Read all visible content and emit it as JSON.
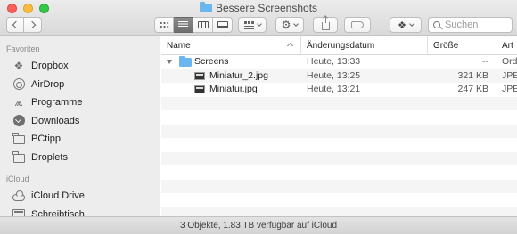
{
  "window": {
    "title": "Bessere Screenshots"
  },
  "toolbar": {
    "search_placeholder": "Suchen"
  },
  "sidebar": {
    "sections": [
      {
        "heading": "Favoriten"
      },
      {
        "heading": "iCloud"
      }
    ],
    "favorites": [
      {
        "label": "Dropbox",
        "icon": "dropbox-icon"
      },
      {
        "label": "AirDrop",
        "icon": "airdrop-icon"
      },
      {
        "label": "Programme",
        "icon": "applications-icon"
      },
      {
        "label": "Downloads",
        "icon": "download-icon"
      },
      {
        "label": "PCtipp",
        "icon": "folder-icon"
      },
      {
        "label": "Droplets",
        "icon": "folder-icon"
      }
    ],
    "icloud": [
      {
        "label": "iCloud Drive",
        "icon": "cloud-icon"
      },
      {
        "label": "Schreibtisch",
        "icon": "desktop-icon"
      }
    ]
  },
  "list": {
    "columns": {
      "name": "Name",
      "date": "Änderungsdatum",
      "size": "Größe",
      "kind": "Art"
    },
    "rows": [
      {
        "name": "Screens",
        "date": "Heute, 13:33",
        "size": "--",
        "kind": "Ord"
      },
      {
        "name": "Miniatur_2.jpg",
        "date": "Heute, 13:25",
        "size": "321 KB",
        "kind": "JPE"
      },
      {
        "name": "Miniatur.jpg",
        "date": "Heute, 13:21",
        "size": "247 KB",
        "kind": "JPE"
      }
    ]
  },
  "status": {
    "text": "3 Objekte, 1.83 TB verfügbar auf iCloud"
  },
  "colors": {
    "folder": "#6cb6f0",
    "sidebar_bg": "#ededed",
    "close": "#fc605b",
    "minimize": "#fdbc40",
    "maximize": "#34c84a"
  }
}
